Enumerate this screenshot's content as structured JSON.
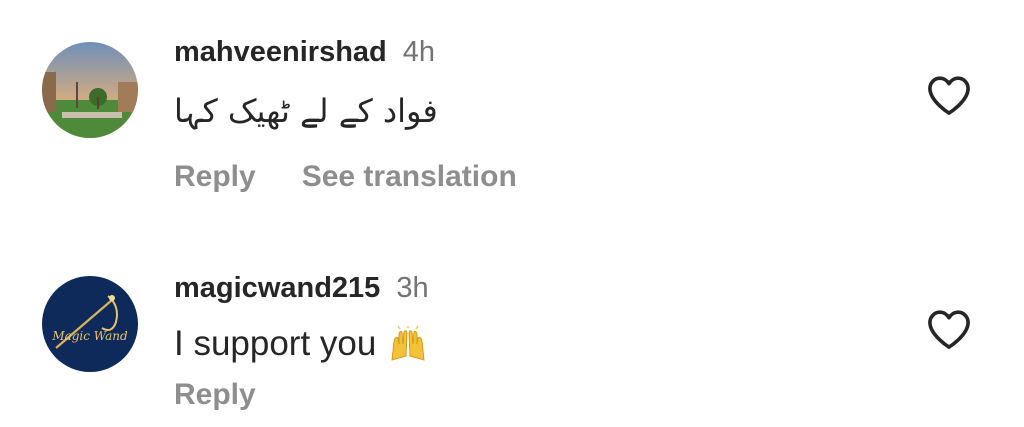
{
  "comments": [
    {
      "username": "mahveenirshad",
      "time": "4h",
      "text": "فواد کے لے ٹھیک کہا",
      "actions": {
        "reply": "Reply",
        "translate": "See translation"
      },
      "avatar": "landscape-photo-avatar"
    },
    {
      "username": "magicwand215",
      "time": "3h",
      "text": "I support you",
      "emoji": "raising-hands-emoji",
      "actions": {
        "reply": "Reply"
      },
      "avatar": "magic-wand-logo-avatar",
      "avatar_text": "Magic Wand"
    }
  ],
  "colors": {
    "username": "#262626",
    "meta": "#737373",
    "action": "#8e8e8e",
    "heart": "#262626"
  }
}
